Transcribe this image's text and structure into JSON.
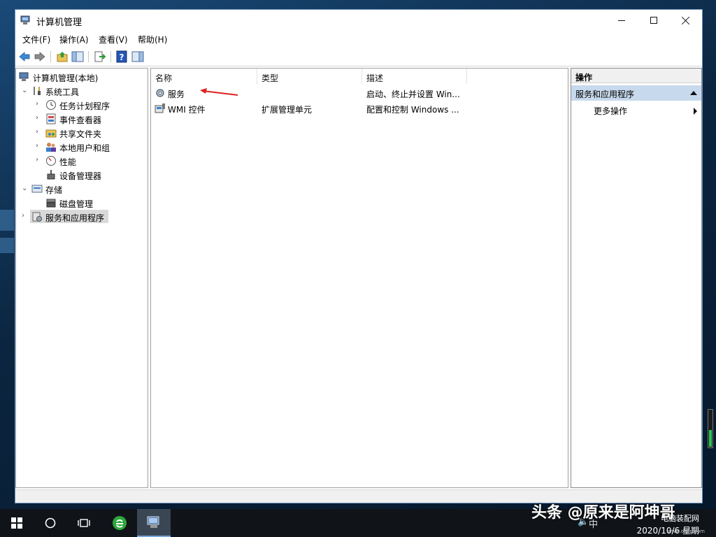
{
  "window": {
    "title": "计算机管理"
  },
  "menu": [
    "文件(F)",
    "操作(A)",
    "查看(V)",
    "帮助(H)"
  ],
  "toolbar": {
    "icons": [
      "back-arrow-icon",
      "forward-arrow-icon",
      "up-folder-icon",
      "show-hide-tree-icon",
      "export-list-icon",
      "help-icon",
      "show-hide-action-pane-icon"
    ]
  },
  "tree": {
    "root": "计算机管理(本地)",
    "system_tools": "系统工具",
    "task_scheduler": "任务计划程序",
    "event_viewer": "事件查看器",
    "shared_folders": "共享文件夹",
    "local_users": "本地用户和组",
    "performance": "性能",
    "device_manager": "设备管理器",
    "storage": "存储",
    "disk_management": "磁盘管理",
    "services_apps": "服务和应用程序"
  },
  "list": {
    "columns": [
      "名称",
      "类型",
      "描述"
    ],
    "rows": [
      {
        "name": "服务",
        "type": "",
        "desc": "启动、终止并设置 Win..."
      },
      {
        "name": "WMI 控件",
        "type": "扩展管理单元",
        "desc": "配置和控制 Windows ..."
      }
    ]
  },
  "actions": {
    "header": "操作",
    "section": "服务和应用程序",
    "more": "更多操作"
  },
  "taskbar": {
    "date": "2020/10/6 星期",
    "ime": "中",
    "watermark": "头条 @原来是阿坤哥",
    "site": "电脑装配网",
    "site_url": "www.dnzp.com"
  },
  "colors": {
    "accent_selection": "#c7d9ec",
    "arrow_annotation": "#e02020",
    "taskbar": "#101419"
  }
}
